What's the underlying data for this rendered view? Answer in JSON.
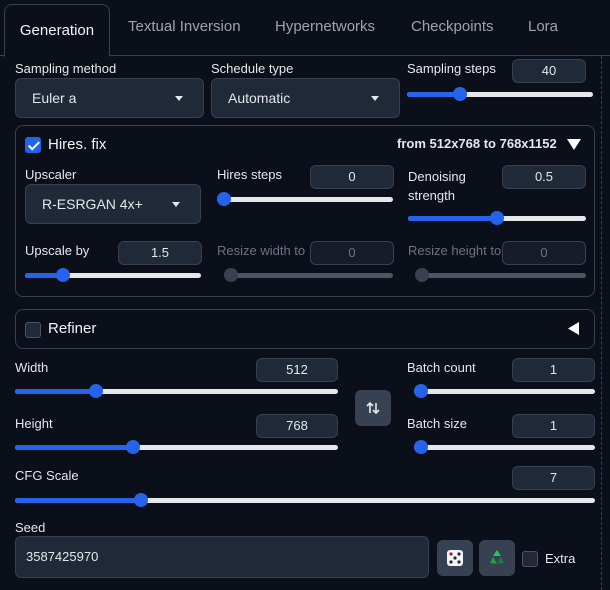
{
  "tabs": [
    "Generation",
    "Textual Inversion",
    "Hypernetworks",
    "Checkpoints",
    "Lora"
  ],
  "sampling": {
    "method_label": "Sampling method",
    "method_value": "Euler a",
    "schedule_label": "Schedule type",
    "schedule_value": "Automatic",
    "steps_label": "Sampling steps",
    "steps_value": "40",
    "steps_fraction": 0.27
  },
  "hires": {
    "title": "Hires. fix",
    "enabled": true,
    "summary": "from 512x768  to 768x1152",
    "upscaler_label": "Upscaler",
    "upscaler_value": "R-ESRGAN 4x+",
    "steps_label": "Hires steps",
    "steps_value": "0",
    "steps_fraction": 0.0,
    "denoise_label": "Denoising strength",
    "denoise_value": "0.5",
    "denoise_fraction": 0.5,
    "upscale_by_label": "Upscale by",
    "upscale_by_value": "1.5",
    "upscale_by_fraction": 0.19,
    "resize_w_label": "Resize width to",
    "resize_w_value": "0",
    "resize_h_label": "Resize height to",
    "resize_h_value": "0"
  },
  "refiner": {
    "title": "Refiner",
    "enabled": false
  },
  "size": {
    "width_label": "Width",
    "width_value": "512",
    "width_fraction": 0.24,
    "height_label": "Height",
    "height_value": "768",
    "height_fraction": 0.36,
    "batch_count_label": "Batch count",
    "batch_count_value": "1",
    "batch_size_label": "Batch size",
    "batch_size_value": "1"
  },
  "cfg": {
    "label": "CFG Scale",
    "value": "7",
    "fraction": 0.21
  },
  "seed": {
    "label": "Seed",
    "value": "3587425970",
    "extra_label": "Extra"
  },
  "colors": {
    "accent": "#2563eb",
    "background": "#0b0f19",
    "recycle": "#22c55e"
  }
}
